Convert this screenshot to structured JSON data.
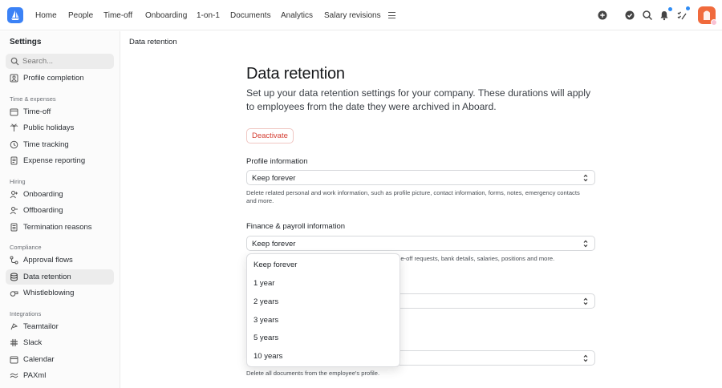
{
  "topbar": {
    "nav": [
      "Home",
      "People",
      "Time-off",
      "Onboarding",
      "1-on-1",
      "Documents",
      "Analytics",
      "Salary revisions"
    ]
  },
  "sidebar": {
    "title": "Settings",
    "search_placeholder": "Search...",
    "top_item": "Profile completion",
    "groups": [
      {
        "title": "Time & expenses",
        "items": [
          "Time-off",
          "Public holidays",
          "Time tracking",
          "Expense reporting"
        ]
      },
      {
        "title": "Hiring",
        "items": [
          "Onboarding",
          "Offboarding",
          "Termination reasons"
        ]
      },
      {
        "title": "Compliance",
        "items": [
          "Approval flows",
          "Data retention",
          "Whistleblowing"
        ]
      },
      {
        "title": "Integrations",
        "items": [
          "Teamtailor",
          "Slack",
          "Calendar",
          "PAXml"
        ]
      }
    ],
    "active_item": "Data retention"
  },
  "main": {
    "breadcrumb": "Data retention",
    "title": "Data retention",
    "subtitle": "Set up your data retention settings for your company. These durations will apply to employees from the date they were archived in Aboard.",
    "deactivate_label": "Deactivate",
    "sections": [
      {
        "label": "Profile information",
        "value": "Keep forever",
        "help": "Delete related personal and work information, such as profile picture, contact information, forms, notes, emergency contacts and more."
      },
      {
        "label": "Finance & payroll information",
        "value": "Keep forever",
        "help_visible": "me-off requests, bank details, salaries, positions and more."
      },
      {
        "value": ""
      },
      {
        "value": "",
        "help": "Delete all documents from the employee's profile."
      }
    ],
    "dropdown_options": [
      "Keep forever",
      "1 year",
      "2 years",
      "3 years",
      "5 years",
      "10 years"
    ]
  },
  "colors": {
    "accent": "#3b82f6",
    "danger": "#d43d32",
    "avatar": "#f06a3c",
    "notify_dot": "#2f8cf4"
  }
}
